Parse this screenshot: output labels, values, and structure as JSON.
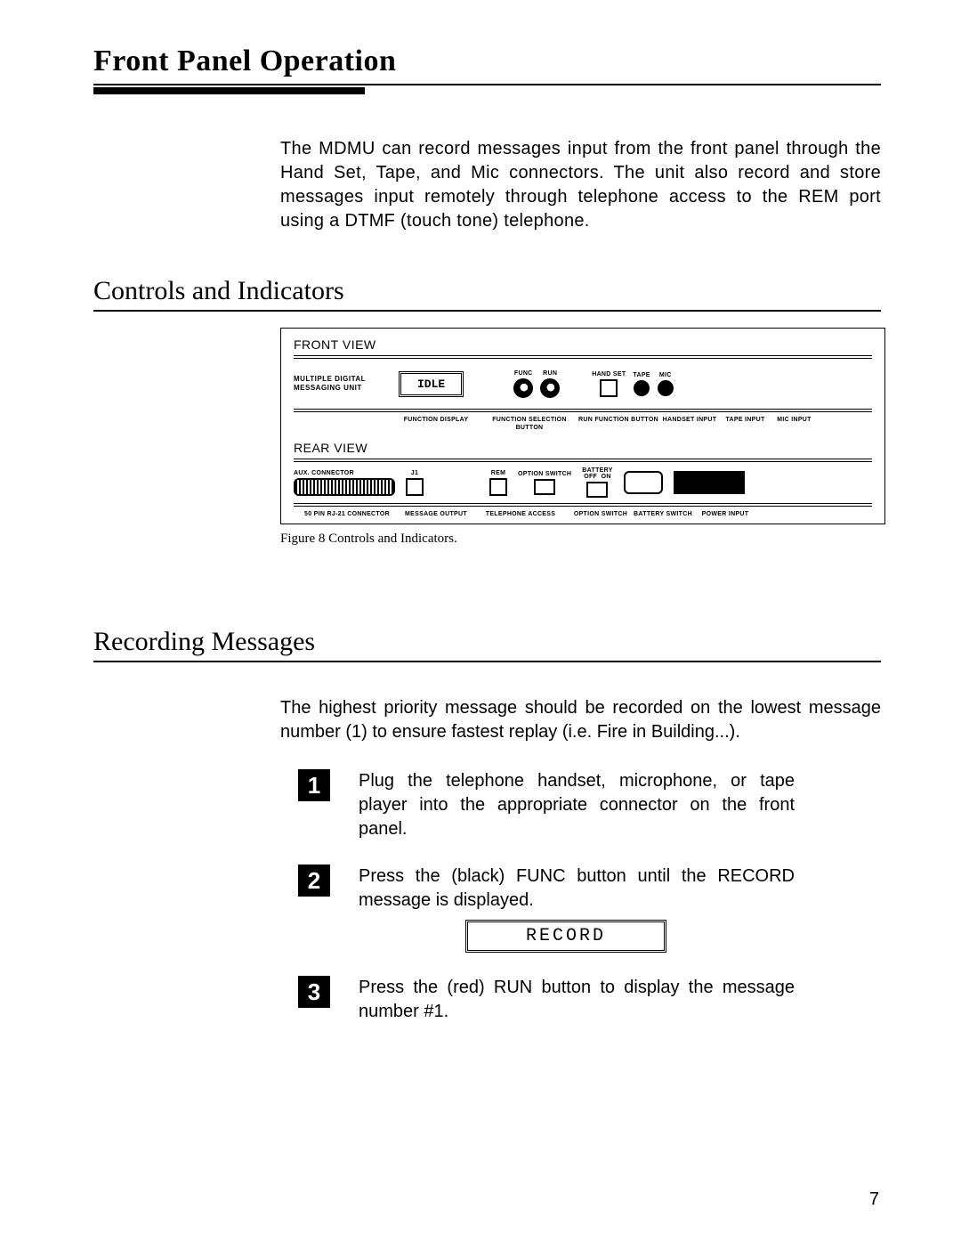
{
  "page": {
    "title": "Front Panel Operation",
    "intro": "The MDMU can record messages input from the front panel through the Hand Set, Tape, and Mic connectors. The unit also record and store messages input remotely through telephone access to the REM port using a DTMF (touch tone) telephone.",
    "number": "7"
  },
  "sections": {
    "controls": {
      "heading": "Controls and Indicators",
      "figure_caption": "Figure 8   Controls and Indicators."
    },
    "recording": {
      "heading": "Recording Messages",
      "intro": "The highest priority message should be recorded on the lowest message number (1) to ensure fastest replay (i.e. Fire in Building...).",
      "steps": [
        {
          "n": "1",
          "text": "Plug the telephone handset, microphone, or tape player into the appropriate connector on the front panel."
        },
        {
          "n": "2",
          "text": "Press the (black) FUNC button until the RECORD message is displayed.",
          "display": "RECORD"
        },
        {
          "n": "3",
          "text": "Press the (red) RUN button to display the message number #1."
        }
      ]
    }
  },
  "figure": {
    "front": {
      "title": "FRONT VIEW",
      "unit_name_l1": "MULTIPLE  DIGITAL",
      "unit_name_l2": "MESSAGING  UNIT",
      "lcd": "IDLE",
      "labels": {
        "func": "FUNC",
        "run": "RUN",
        "handset": "HAND SET",
        "tape": "TAPE",
        "mic": "MIC"
      },
      "callouts": [
        "FUNCTION DISPLAY",
        "FUNCTION SELECTION BUTTON",
        "RUN FUNCTION BUTTON",
        "HANDSET INPUT",
        "TAPE INPUT",
        "MIC INPUT"
      ]
    },
    "rear": {
      "title": "REAR VIEW",
      "labels": {
        "aux": "AUX.  CONNECTOR",
        "j1": "J1",
        "rem": "REM",
        "opt": "OPTION SWITCH",
        "batt": "BATTERY",
        "off": "OFF",
        "on": "ON"
      },
      "callouts": [
        "50 PIN RJ-21 CONNECTOR",
        "MESSAGE OUTPUT",
        "TELEPHONE ACCESS",
        "OPTION SWITCH",
        "BATTERY SWITCH",
        "POWER INPUT"
      ]
    }
  }
}
